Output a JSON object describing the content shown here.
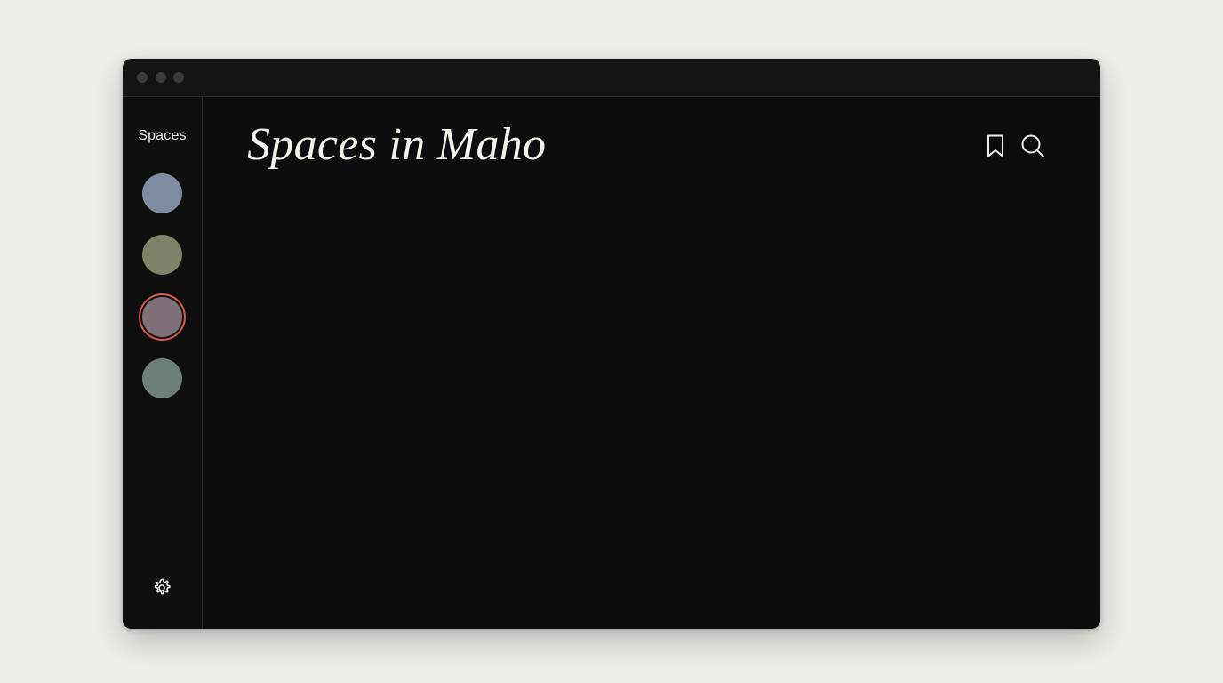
{
  "sidebar": {
    "title": "Spaces",
    "spaces": [
      {
        "color": "#7e8ba0",
        "active": false
      },
      {
        "color": "#7e8266",
        "active": false
      },
      {
        "color": "#7f7179",
        "active": true
      },
      {
        "color": "#6c7f78",
        "active": false
      }
    ],
    "active_ring_color": "#d85a4a",
    "settings_icon": "gear-icon"
  },
  "main": {
    "title": "Spaces in Maho",
    "actions": [
      {
        "icon": "bookmark-icon"
      },
      {
        "icon": "search-icon"
      }
    ]
  }
}
